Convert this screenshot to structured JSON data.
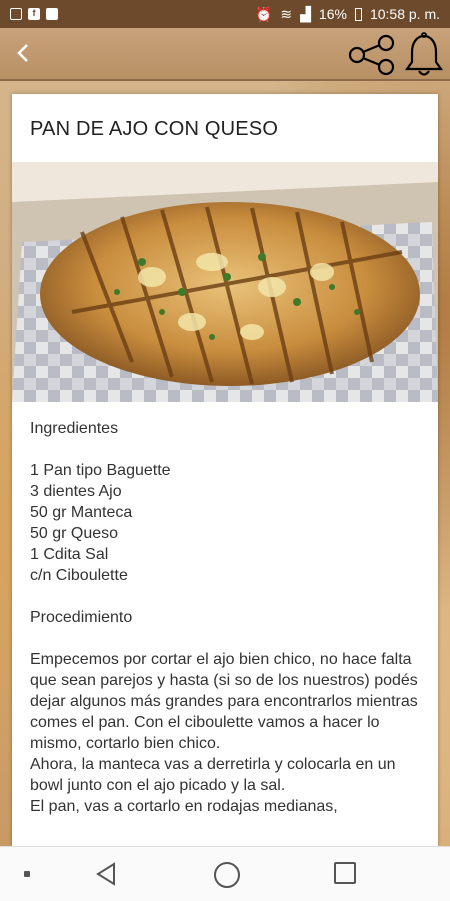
{
  "status_bar": {
    "battery": "16%",
    "time": "10:58 p. m."
  },
  "icons": {
    "back": "back-arrow-icon",
    "share": "share-icon",
    "bell": "bell-icon"
  },
  "recipe": {
    "title": "PAN DE AJO CON QUESO",
    "ingredients_heading": "Ingredientes",
    "ingredients": [
      "1 Pan tipo Baguette",
      "3 dientes Ajo",
      "50 gr Manteca",
      "50 gr Queso",
      "1 Cdita Sal",
      "c/n Ciboulette"
    ],
    "procedure_heading": "Procedimiento",
    "procedure": [
      "Empecemos por cortar el ajo bien chico, no hace falta que sean parejos y hasta (si so de los nuestros) podés dejar algunos más grandes para encontrarlos mientras comes el pan. Con el ciboulette vamos a hacer lo mismo, cortarlo bien chico.",
      "Ahora, la manteca vas a derretirla y colocarla en un bowl junto con el ajo picado y la sal.",
      "El pan, vas a cortarlo en rodajas medianas,"
    ]
  },
  "colors": {
    "status_bar": "#6e4a2c",
    "app_bar": "#c8a27a",
    "card": "#ffffff"
  }
}
